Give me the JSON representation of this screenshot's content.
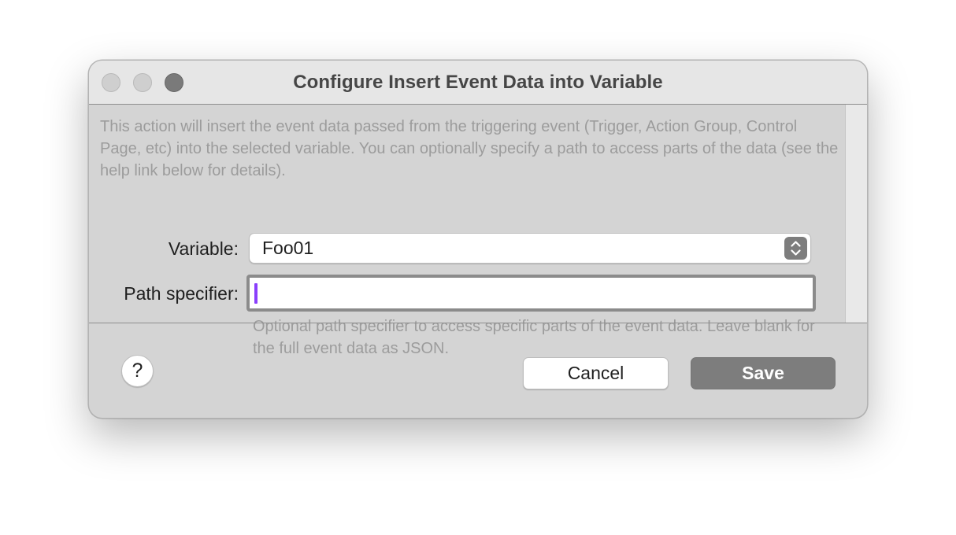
{
  "window": {
    "title": "Configure Insert Event Data into Variable"
  },
  "description": "This action will insert the event data passed from the triggering event (Trigger, Action Group, Control Page, etc) into the selected variable. You can optionally specify a path to access parts of the data (see the help link below for details).",
  "form": {
    "variable_label": "Variable:",
    "variable_value": "Foo01",
    "path_label": "Path specifier:",
    "path_value": "",
    "path_hint": "Optional path specifier to access specific parts of the event data. Leave blank for the full event data as JSON."
  },
  "footer": {
    "help_label": "?",
    "cancel_label": "Cancel",
    "save_label": "Save"
  },
  "icons": {
    "close": "close-icon",
    "minimize": "minimize-icon",
    "zoom": "zoom-icon",
    "stepper": "chevron-up-down-icon"
  },
  "colors": {
    "caret": "#8a3ffc",
    "primary_button": "#7d7d7d",
    "window_bg": "#d4d4d4"
  }
}
